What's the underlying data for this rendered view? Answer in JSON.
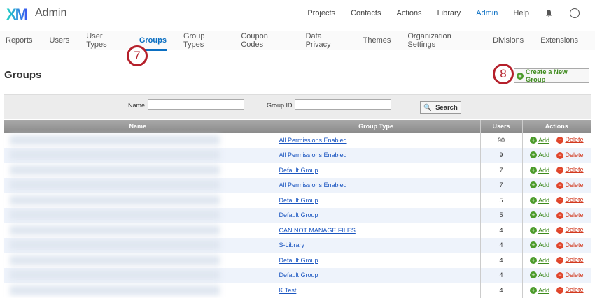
{
  "header": {
    "logo": "XM",
    "app_title": "Admin",
    "nav": [
      "Projects",
      "Contacts",
      "Actions",
      "Library",
      "Admin",
      "Help"
    ],
    "active": "Admin"
  },
  "subnav": {
    "items": [
      "Reports",
      "Users",
      "User Types",
      "Groups",
      "Group Types",
      "Coupon Codes",
      "Data Privacy",
      "Themes",
      "Organization Settings",
      "Divisions",
      "Extensions"
    ],
    "active": "Groups"
  },
  "callouts": {
    "groups_tab": "7",
    "create_button": "8"
  },
  "page": {
    "title": "Groups",
    "create_label": "Create a New Group"
  },
  "search": {
    "name_label": "Name",
    "name_value": "",
    "group_id_label": "Group ID",
    "group_id_value": "",
    "button": "Search"
  },
  "table": {
    "headers": [
      "Name",
      "Group Type",
      "Users",
      "Actions"
    ],
    "add_label": "Add",
    "delete_label": "Delete",
    "rows": [
      {
        "type": "All Permissions Enabled",
        "users": "90"
      },
      {
        "type": "All Permissions Enabled",
        "users": "9"
      },
      {
        "type": "Default Group",
        "users": "7"
      },
      {
        "type": "All Permissions Enabled",
        "users": "7"
      },
      {
        "type": "Default Group",
        "users": "5"
      },
      {
        "type": "Default Group",
        "users": "5"
      },
      {
        "type": "CAN NOT MANAGE FILES",
        "users": "4"
      },
      {
        "type": "S-Library",
        "users": "4"
      },
      {
        "type": "Default Group",
        "users": "4"
      },
      {
        "type": "Default Group",
        "users": "4"
      },
      {
        "type": "K Test",
        "users": "4"
      }
    ]
  }
}
